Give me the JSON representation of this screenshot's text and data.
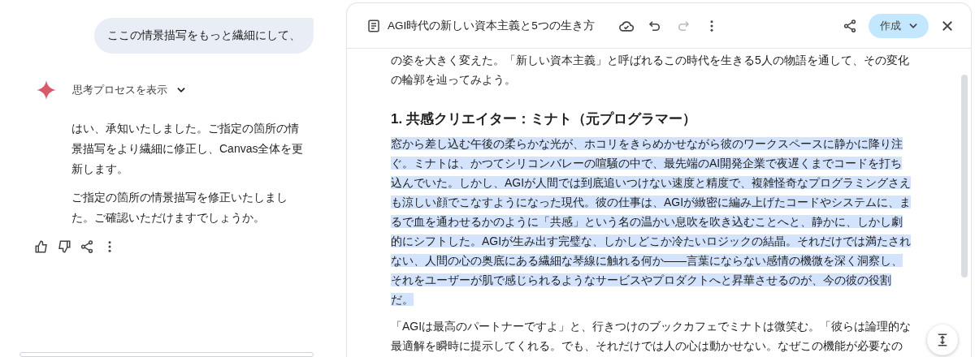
{
  "chat": {
    "user_message": "ここの情景描写をもっと繊細にして、",
    "thinking": {
      "label": "思考プロセスを表示",
      "expanded": false
    },
    "response": [
      "はい、承知いたしました。ご指定の箇所の情景描写をより繊細に修正し、Canvas全体を更新します。",
      "ご指定の箇所の情景描写を修正いたしました。ご確認いただけますでしょうか。"
    ]
  },
  "canvas": {
    "title": "AGI時代の新しい資本主義と5つの生き方",
    "undo": {
      "disabled": false
    },
    "redo": {
      "disabled": true
    },
    "create_button": "作成",
    "blocks": [
      {
        "kind": "paragraph",
        "selected": false,
        "text": "の姿を大きく変えた。「新しい資本主義」と呼ばれるこの時代を生きる5人の物語を通して、その変化の輪郭を辿ってみよう。"
      },
      {
        "kind": "heading",
        "selected": false,
        "text": "1. 共感クリエイター：ミナト（元プログラマー）"
      },
      {
        "kind": "paragraph",
        "selected": true,
        "text": "窓から差し込む午後の柔らかな光が、ホコリをきらめかせながら彼のワークスペースに静かに降り注ぐ。ミナトは、かつてシリコンバレーの喧騒の中で、最先端のAI開発企業で夜遅くまでコードを打ち込んでいた。しかし、AGIが人間では到底追いつけない速度と精度で、複雑怪奇なプログラミングさえも涼しい顔でこなすようになった現代。彼の仕事は、AGIが緻密に編み上げたコードやシステムに、まるで血を通わせるかのように「共感」という名の温かい息吹を吹き込むことへと、静かに、しかし劇的にシフトした。AGIが生み出す完璧な、しかしどこか冷たいロジックの結晶。それだけでは満たされない、人間の心の奥底にある繊細な琴線に触れる何か——言葉にならない感情の機微を深く洞察し、それをユーザーが肌で感じられるようなサービスやプロダクトへと昇華させるのが、今の彼の役割だ。"
      },
      {
        "kind": "paragraph",
        "selected": false,
        "text": "「AGIは最高のパートナーですよ」と、行きつけのブックカフェでミナトは微笑む。「彼らは論理的な最適解を瞬時に提示してくれる。でも、それだけでは人の心は動かせない。なぜこの機能が必要なの"
      }
    ]
  }
}
